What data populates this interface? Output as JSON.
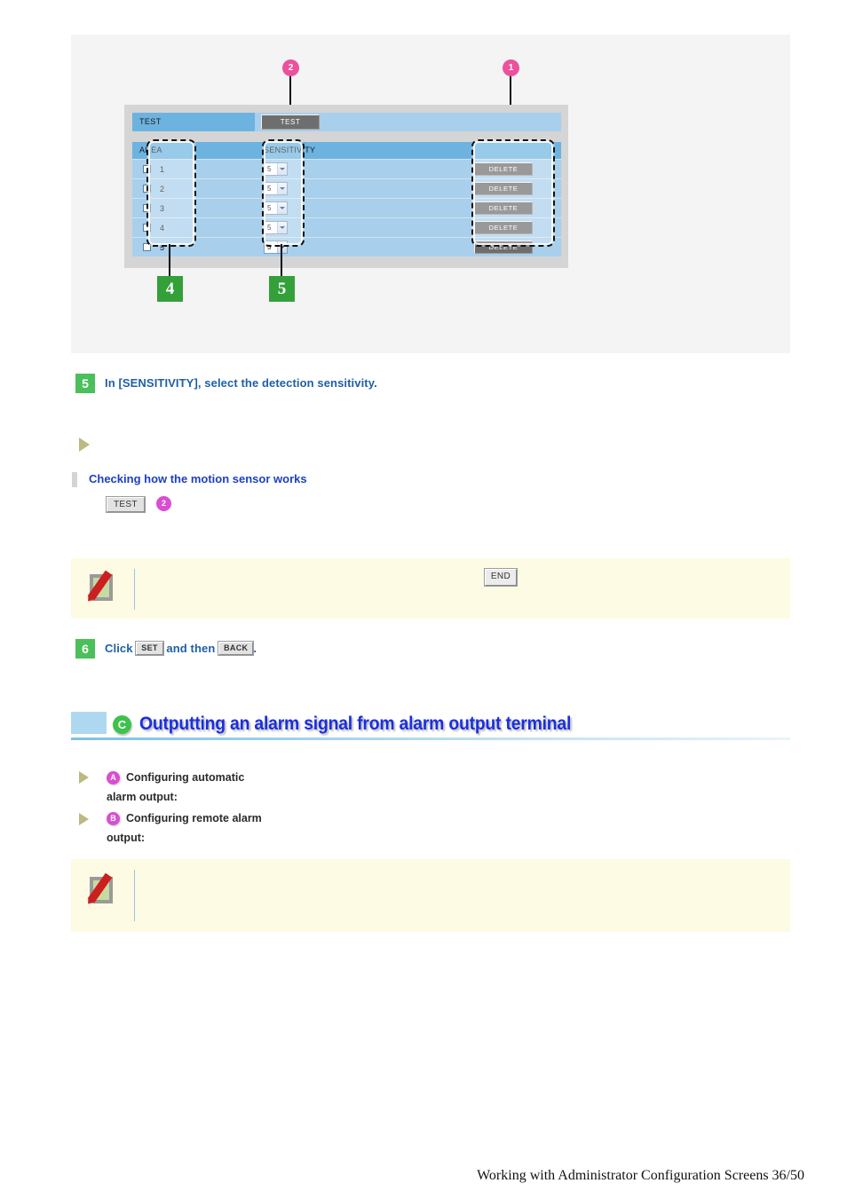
{
  "figure": {
    "ui": {
      "test_row": {
        "label": "TEST",
        "button_label": "TEST"
      },
      "table": {
        "headers": [
          "AREA",
          "SENSITIVITY"
        ],
        "rows": [
          {
            "num": "1",
            "sensitivity": "5",
            "delete_label": "DELETE"
          },
          {
            "num": "2",
            "sensitivity": "5",
            "delete_label": "DELETE"
          },
          {
            "num": "3",
            "sensitivity": "5",
            "delete_label": "DELETE"
          },
          {
            "num": "4",
            "sensitivity": "5",
            "delete_label": "DELETE"
          },
          {
            "num": "5",
            "sensitivity": "5",
            "delete_label": "DELETE"
          }
        ]
      }
    },
    "callouts": {
      "pink": [
        {
          "id": "1",
          "label": "1"
        },
        {
          "id": "2",
          "label": "2"
        }
      ],
      "green": [
        {
          "id": "4",
          "label": "4"
        },
        {
          "id": "5",
          "label": "5"
        }
      ]
    },
    "colors": {
      "callout_pink": "#ec519e",
      "callout_green": "#33a03a",
      "panel_gray": "#d5d5d5",
      "row_blue": "#a8cfeb",
      "header_blue": "#6cb3e0",
      "button_gray": "#6e6e6e"
    }
  },
  "steps": [
    {
      "number": "5",
      "text": "In [SENSITIVITY], select the detection sensitivity."
    }
  ],
  "check_section": {
    "title": "Checking how the motion sensor works",
    "test_button_label": "TEST",
    "callout_label": "2"
  },
  "note_top": {
    "end_button_label": "END"
  },
  "step6": {
    "number": "6",
    "prefix": "Click",
    "set_button_label": "SET",
    "middle": "and then",
    "back_button_label": "BACK",
    "suffix": "."
  },
  "section_c": {
    "badge": "C",
    "title": "Outputting an alarm signal from alarm output terminal",
    "links": [
      {
        "badge": "A",
        "line1": "Configuring automatic",
        "line2": "alarm output:"
      },
      {
        "badge": "B",
        "line1": "Configuring remote alarm",
        "line2": "output:"
      }
    ],
    "accent_color": "#1a2ee0",
    "badge_color": "#3dc24b"
  },
  "footer": {
    "text": "Working with Administrator Configuration Screens 36/50"
  }
}
